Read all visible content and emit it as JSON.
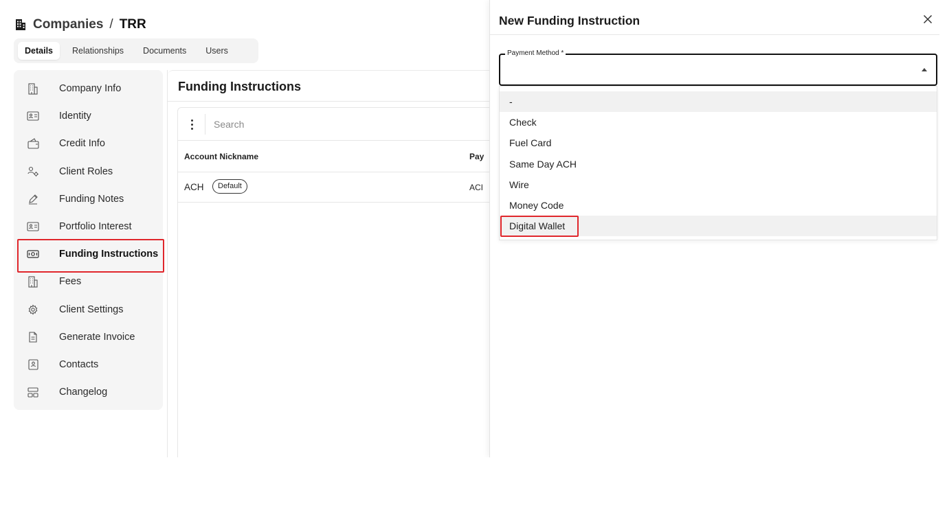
{
  "header": {
    "crumb": "Companies",
    "separator": "/",
    "current": "TRR"
  },
  "tabs": [
    {
      "label": "Details",
      "active": true
    },
    {
      "label": "Relationships",
      "active": false
    },
    {
      "label": "Documents",
      "active": false
    },
    {
      "label": "Users",
      "active": false
    }
  ],
  "sidebar": {
    "items": [
      {
        "label": "Company Info",
        "icon": "building-icon"
      },
      {
        "label": "Identity",
        "icon": "id-card-icon"
      },
      {
        "label": "Credit Info",
        "icon": "wallet-icon"
      },
      {
        "label": "Client Roles",
        "icon": "users-gear-icon"
      },
      {
        "label": "Funding Notes",
        "icon": "pen-icon"
      },
      {
        "label": "Portfolio Interest",
        "icon": "id-card-icon"
      },
      {
        "label": "Funding Instructions",
        "icon": "money-icon",
        "active": true
      },
      {
        "label": "Fees",
        "icon": "building-icon"
      },
      {
        "label": "Client Settings",
        "icon": "gear-icon"
      },
      {
        "label": "Generate Invoice",
        "icon": "document-icon"
      },
      {
        "label": "Contacts",
        "icon": "contact-icon"
      },
      {
        "label": "Changelog",
        "icon": "layout-icon"
      }
    ]
  },
  "main": {
    "title": "Funding Instructions",
    "search_placeholder": "Search",
    "columns": [
      "Account Nickname",
      "Pay"
    ],
    "rows": [
      {
        "nickname": "ACH",
        "badge": "Default",
        "payment": "ACI"
      }
    ]
  },
  "drawer": {
    "title": "New Funding Instruction",
    "field_label": "Payment Method *",
    "options": [
      "-",
      "Check",
      "Fuel Card",
      "Same Day ACH",
      "Wire",
      "Money Code",
      "Digital Wallet"
    ],
    "highlighted_option": "Digital Wallet"
  },
  "colors": {
    "highlight_border": "#e0262b",
    "sidebar_bg": "#f5f5f5",
    "tabs_bg": "#f3f3f3"
  }
}
